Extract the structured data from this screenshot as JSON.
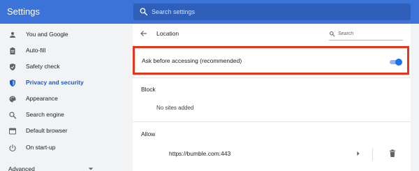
{
  "app": {
    "title": "Settings"
  },
  "search": {
    "placeholder": "Search settings",
    "icon": "search-icon"
  },
  "sidebar": {
    "items": [
      {
        "label": "You and Google",
        "icon": "person-icon"
      },
      {
        "label": "Auto-fill",
        "icon": "clipboard-icon"
      },
      {
        "label": "Safety check",
        "icon": "shield-check-icon"
      },
      {
        "label": "Privacy and security",
        "icon": "shield-icon",
        "active": true
      },
      {
        "label": "Appearance",
        "icon": "palette-icon"
      },
      {
        "label": "Search engine",
        "icon": "search-icon"
      },
      {
        "label": "Default browser",
        "icon": "browser-icon"
      },
      {
        "label": "On start-up",
        "icon": "power-icon"
      }
    ],
    "advanced_label": "Advanced"
  },
  "page": {
    "title": "Location",
    "search_placeholder": "Search",
    "ask_label": "Ask before accessing (recommended)",
    "ask_enabled": true,
    "block_label": "Block",
    "block_empty": "No sites added",
    "allow_label": "Allow",
    "allow_sites": [
      "https://bumble.com:443"
    ]
  },
  "colors": {
    "topbar": "#3b73d9",
    "accent": "#1a73e8",
    "highlight_border": "#e8351c"
  }
}
